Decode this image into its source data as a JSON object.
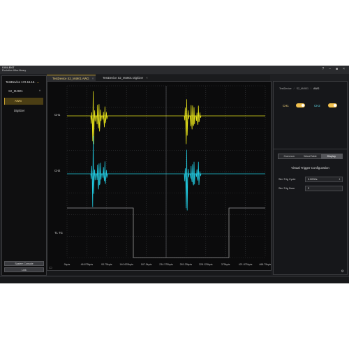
{
  "app": {
    "brand_line1": "SIGLENT",
    "brand_line2": "Evolution Ultra library",
    "window_controls": [
      "?",
      "–",
      "■",
      "×"
    ]
  },
  "sidebar": {
    "device": "TestDevice 172.16.15.",
    "module": "S2_M4901",
    "items": [
      {
        "label": "AWG",
        "active": true
      },
      {
        "label": "Digitizer",
        "active": false
      }
    ],
    "system_console_label": "System Console",
    "link_label": "Link"
  },
  "tabs": [
    {
      "label": "TestDevice S2_M4901 AWG",
      "active": true
    },
    {
      "label": "TestDevice S2_M4901 Digitizer",
      "active": false
    }
  ],
  "scope": {
    "trace_labels": [
      "CH1",
      "CH2",
      "T1 TG"
    ],
    "x_ticks": [
      "0kpts",
      "46.875kpts",
      "93.75kpts",
      "140.625kpts",
      "187.5kpts",
      "234.375kpts",
      "281.25kpts",
      "328.125kpts",
      "375kpts",
      "421.875kpts",
      "468.75kpts"
    ],
    "colors": {
      "ch1": "#e6e21a",
      "ch2": "#21c8de",
      "trigger": "#9a9a9a",
      "grid": "#3a3b3e"
    }
  },
  "panel": {
    "breadcrumb": [
      "TestDevice",
      "S2_M4901",
      "AWG"
    ],
    "ch1_label": "CH1",
    "ch2_label": "CH2",
    "ch1_enabled": true,
    "ch2_enabled": true,
    "tabs": [
      {
        "label": "Common",
        "active": false
      },
      {
        "label": "WaveTable",
        "active": false
      },
      {
        "label": "Display",
        "active": true
      }
    ],
    "section_title": "Virtual Trigger Configuration",
    "sim_trig_cycle_label": "Sim Trig Cycle",
    "sim_trig_cycle_value": "0.0000s",
    "sim_trig_num_label": "Sim Trig Num",
    "sim_trig_num_value": "2"
  },
  "icons": {
    "control": "screen-icon",
    "settings": "gear-icon"
  }
}
